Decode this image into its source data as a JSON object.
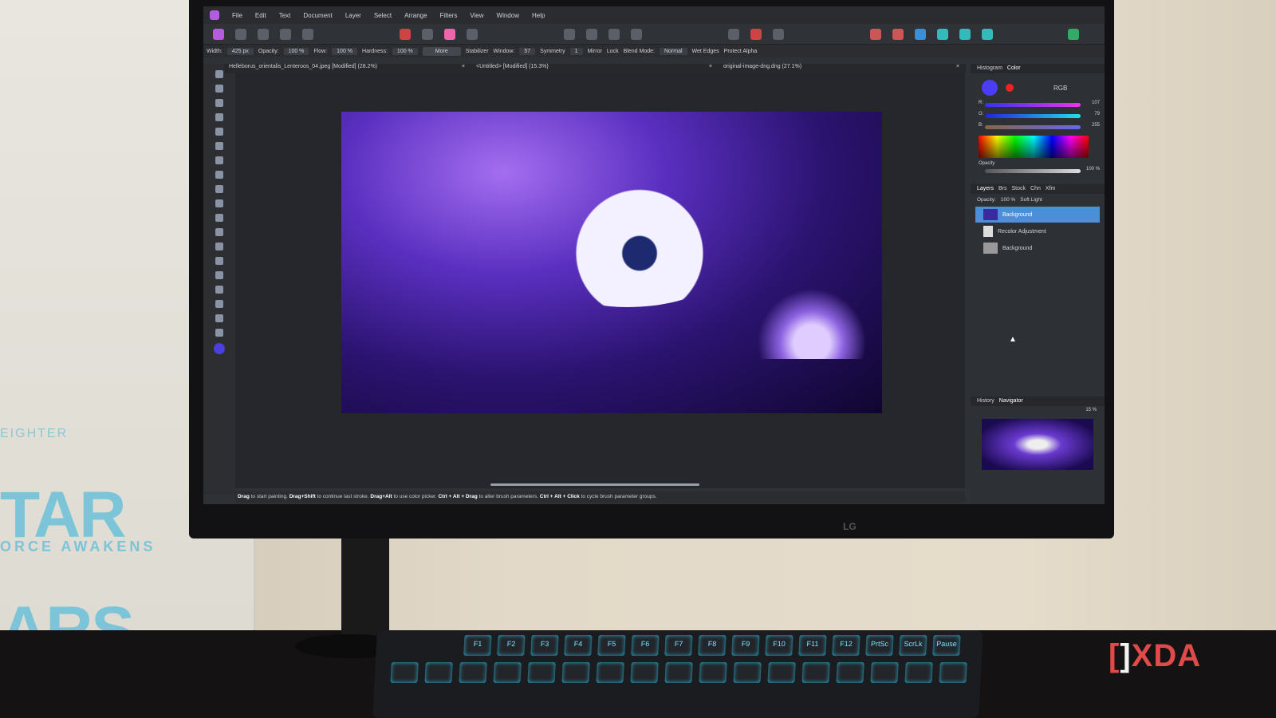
{
  "menu": [
    "File",
    "Edit",
    "Text",
    "Document",
    "Layer",
    "Select",
    "Arrange",
    "Filters",
    "View",
    "Window",
    "Help"
  ],
  "context": {
    "width_label": "Width:",
    "width": "425 px",
    "opacity_label": "Opacity:",
    "opacity": "100 %",
    "flow_label": "Flow:",
    "flow": "100 %",
    "hardness_label": "Hardness:",
    "hardness": "100 %",
    "more": "More",
    "stabilizer": "Stabilizer",
    "window_label": "Window:",
    "window": "57",
    "symmetry": "Symmetry",
    "symmetry_val": "1",
    "mirror": "Mirror",
    "lock": "Lock",
    "blend_label": "Blend Mode:",
    "blend": "Normal",
    "wet_edges": "Wet Edges",
    "protect_alpha": "Protect Alpha"
  },
  "tabs": [
    "Helleborus_orientalis_Lenteroos_04.jpeg [Modified] (28.2%)",
    "<Untitled> [Modified] (15.3%)",
    "original-image-dng.dng (27.1%)"
  ],
  "status": {
    "drag": "Drag",
    "t1": " to start painting. ",
    "shift": "Drag+Shift",
    "t2": " to continue last stroke. ",
    "alt": "Drag+Alt",
    "t3": " to use color picker. ",
    "ctrlalt": "Ctrl + Alt + Drag",
    "t4": " to alter brush parameters. ",
    "click": "Ctrl + Alt + Click",
    "t5": " to cycle brush parameter groups."
  },
  "color_panel": {
    "tabs": [
      "Histogram",
      "Color"
    ],
    "mode": "RGB",
    "r_label": "R:",
    "r": "107",
    "g_label": "G:",
    "g": "79",
    "b_label": "B:",
    "b": "255",
    "opacity_label": "Opacity",
    "opacity": "100 %",
    "values": {
      "r": 107,
      "g": 79,
      "b": 255
    }
  },
  "layers_panel": {
    "tabs": [
      "Layers",
      "Brs",
      "Stock",
      "Chn",
      "Xfm"
    ],
    "opacity_label": "Opacity:",
    "opacity": "100 %",
    "blend": "Soft Light",
    "layers": [
      "Background",
      "Recolor Adjustment",
      "Background"
    ]
  },
  "nav_panel": {
    "tabs": [
      "History",
      "Navigator"
    ],
    "zoom": "15 %"
  },
  "monitor_brand": "LG",
  "watermark": "XDA",
  "keys": [
    "F1",
    "F2",
    "F3",
    "F4",
    "F5",
    "F6",
    "F7",
    "F8",
    "F9",
    "F10",
    "F11",
    "F12",
    "PrtSc",
    "ScrLk",
    "Pause"
  ]
}
